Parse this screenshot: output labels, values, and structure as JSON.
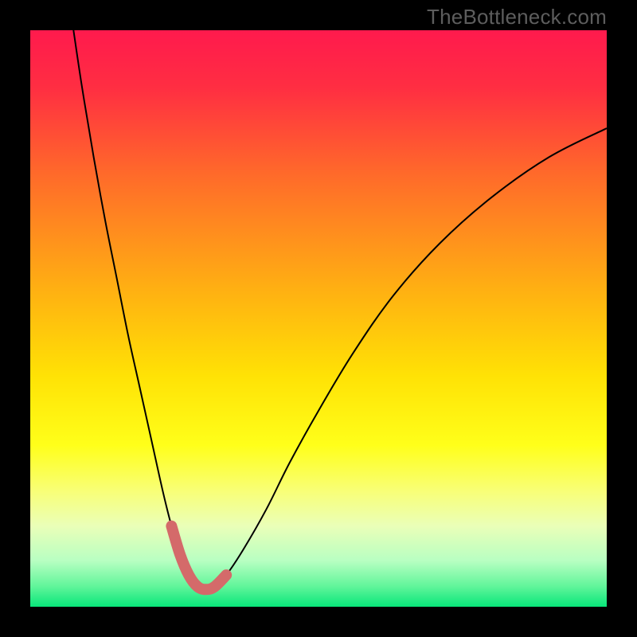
{
  "watermark": "TheBottleneck.com",
  "chart_data": {
    "type": "line",
    "title": "",
    "xlabel": "",
    "ylabel": "",
    "xlim": [
      0,
      100
    ],
    "ylim": [
      0,
      100
    ],
    "background_gradient_stops": [
      {
        "offset": 0.0,
        "color": "#ff1a4d"
      },
      {
        "offset": 0.1,
        "color": "#ff2e42"
      },
      {
        "offset": 0.25,
        "color": "#ff6a2a"
      },
      {
        "offset": 0.45,
        "color": "#ffb012"
      },
      {
        "offset": 0.6,
        "color": "#ffe205"
      },
      {
        "offset": 0.72,
        "color": "#ffff1a"
      },
      {
        "offset": 0.8,
        "color": "#f8ff78"
      },
      {
        "offset": 0.86,
        "color": "#eaffb8"
      },
      {
        "offset": 0.92,
        "color": "#b8ffc2"
      },
      {
        "offset": 0.965,
        "color": "#60f59a"
      },
      {
        "offset": 1.0,
        "color": "#08e67a"
      }
    ],
    "series": [
      {
        "name": "bottleneck-curve",
        "color": "#000000",
        "stroke_width": 2.0,
        "x": [
          7.5,
          9,
          11,
          13,
          15,
          17,
          19,
          21,
          23,
          24.5,
          26,
          27.5,
          29,
          30.5,
          32,
          34,
          37,
          41,
          45,
          50,
          56,
          63,
          71,
          80,
          90,
          100
        ],
        "y": [
          100,
          90,
          78,
          67,
          57,
          47,
          38,
          29,
          20,
          14,
          9,
          5.5,
          3.5,
          3,
          3.5,
          5.5,
          10,
          17,
          25,
          34,
          44,
          54,
          63,
          71,
          78,
          83
        ]
      },
      {
        "name": "optimal-zone-marker",
        "color": "#d46a6a",
        "stroke_width": 14,
        "linecap": "round",
        "x": [
          24.5,
          26,
          27.5,
          29,
          30.5,
          32,
          34
        ],
        "y": [
          14,
          9,
          5.5,
          3.5,
          3,
          3.5,
          5.5
        ]
      }
    ]
  }
}
